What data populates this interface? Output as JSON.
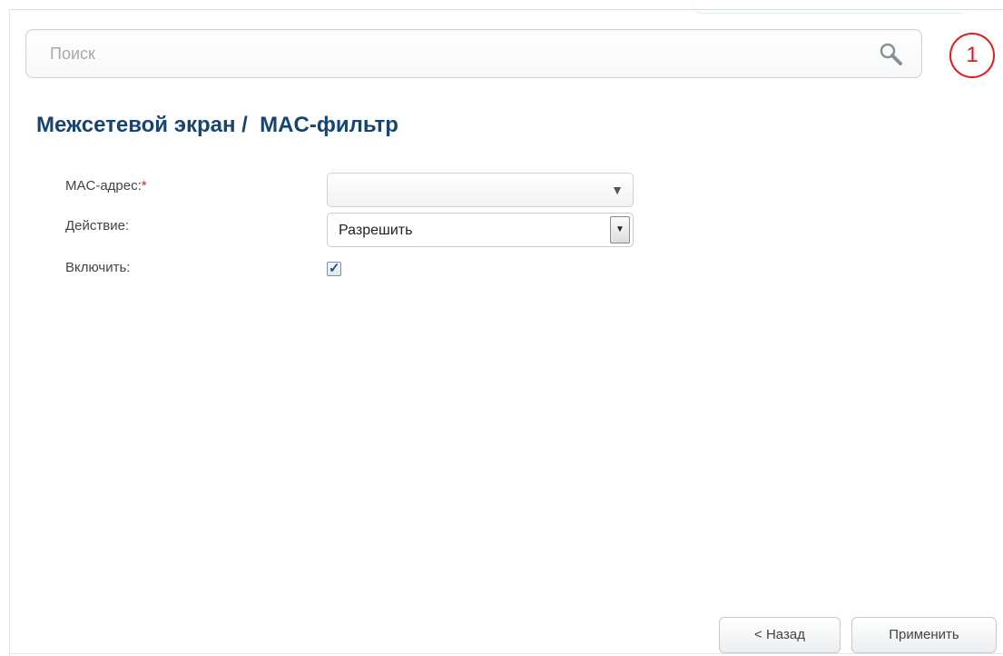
{
  "search": {
    "placeholder": "Поиск"
  },
  "marker": {
    "number": "1",
    "color": "#e01b1b"
  },
  "page": {
    "title": "Межсетевой экран /  MAC-фильтр"
  },
  "form": {
    "mac_label": "MAC-адрес:",
    "mac_required": "*",
    "mac_value": "",
    "action_label": "Действие:",
    "action_value": "Разрешить",
    "enable_label": "Включить:",
    "enable_checked": true
  },
  "buttons": {
    "back": "< Назад",
    "apply": "Применить"
  },
  "colors": {
    "title": "#16456f",
    "required": "#e02020"
  }
}
